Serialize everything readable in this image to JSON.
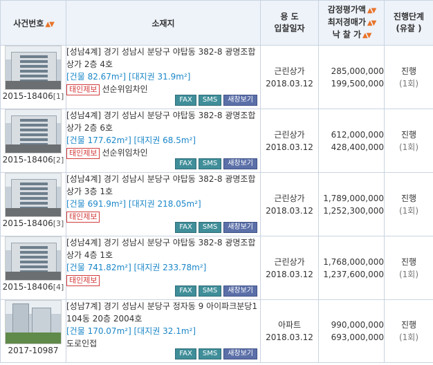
{
  "header": {
    "case_no": "사건번호",
    "location": "소재지",
    "use_line1": "용 도",
    "use_line2": "입찰일자",
    "price_line1": "감정평가액",
    "price_line2": "최저경매가",
    "price_line3": "낙 찰 가",
    "stage_line1": "진행단계",
    "stage_line2": "(유찰 )"
  },
  "buttons": {
    "fax": "FAX",
    "sms": "SMS",
    "new_window": "새창보기"
  },
  "rows": [
    {
      "photo": "building",
      "case_no": "2015-18406",
      "sub_no": "[1]",
      "address": "[성남4계] 경기 성남시 분당구 야탑동 382-8 광명조합상가 2층 4호",
      "area": "[건물 82.67m²] [대지권 31.9m²]",
      "badge": "태인제보",
      "note": "선순위임차인",
      "use": "근린상가",
      "date": "2018.03.12",
      "appraisal": "285,000,000",
      "minimum": "199,500,000",
      "status": "진행",
      "fail_count": "(1회)"
    },
    {
      "photo": "building",
      "case_no": "2015-18406",
      "sub_no": "[2]",
      "address": "[성남4계] 경기 성남시 분당구 야탑동 382-8 광명조합상가 2층 6호",
      "area": "[건물 177.62m²] [대지권 68.5m²]",
      "badge": "태인제보",
      "note": "선순위임차인",
      "use": "근린상가",
      "date": "2018.03.12",
      "appraisal": "612,000,000",
      "minimum": "428,400,000",
      "status": "진행",
      "fail_count": "(1회)"
    },
    {
      "photo": "building",
      "case_no": "2015-18406",
      "sub_no": "[3]",
      "address": "[성남4계] 경기 성남시 분당구 야탑동 382-8 광명조합상가 3층 1호",
      "area": "[건물 691.9m²] [대지권 218.05m²]",
      "badge": "태인제보",
      "note": "",
      "use": "근린상가",
      "date": "2018.03.12",
      "appraisal": "1,789,000,000",
      "minimum": "1,252,300,000",
      "status": "진행",
      "fail_count": "(1회)"
    },
    {
      "photo": "building",
      "case_no": "2015-18406",
      "sub_no": "[4]",
      "address": "[성남4계] 경기 성남시 분당구 야탑동 382-8 광명조합상가 4층 1호",
      "area": "[건물 741.82m²] [대지권 233.78m²]",
      "badge": "태인제보",
      "note": "",
      "use": "근린상가",
      "date": "2018.03.12",
      "appraisal": "1,768,000,000",
      "minimum": "1,237,600,000",
      "status": "진행",
      "fail_count": "(1회)"
    },
    {
      "photo": "apartment",
      "case_no": "2017-10987",
      "sub_no": "",
      "address": "[성남7계] 경기 성남시 분당구 정자동 9 아이파크분당1 104동 20층 2004호",
      "area": "[건물 170.07m²] [대지권 32.1m²]",
      "badge": "",
      "note": "도로인접",
      "use": "아파트",
      "date": "2018.03.12",
      "appraisal": "990,000,000",
      "minimum": "693,000,000",
      "status": "진행",
      "fail_count": "(1회)"
    }
  ]
}
